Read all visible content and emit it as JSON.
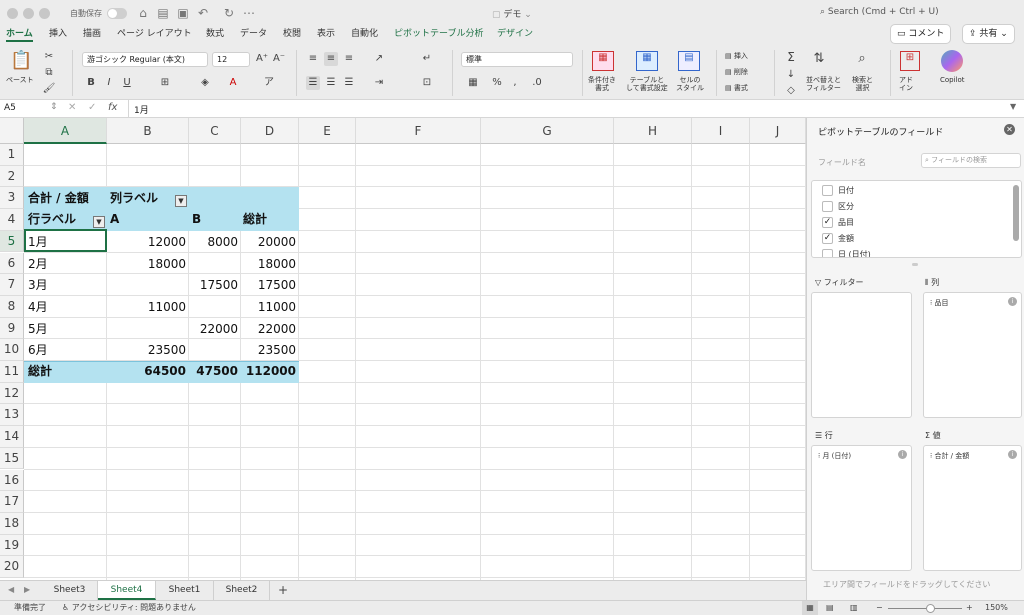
{
  "window": {
    "title": "デモ",
    "autosave_label": "自動保存",
    "search_placeholder": "Search (Cmd + Ctrl + U)"
  },
  "tabs": [
    "ホーム",
    "挿入",
    "描画",
    "ページ レイアウト",
    "数式",
    "データ",
    "校閲",
    "表示",
    "自動化",
    "ピボットテーブル分析",
    "デザイン"
  ],
  "header_buttons": {
    "comment": "コメント",
    "share": "共有"
  },
  "ribbon": {
    "paste": "ペースト",
    "font_name": "游ゴシック Regular (本文)",
    "font_size": "12",
    "number_format": "標準",
    "conditional_format": [
      "条件付き",
      "書式"
    ],
    "format_as_table": [
      "テーブルと",
      "して書式設定"
    ],
    "cell_styles": [
      "セルの",
      "スタイル"
    ],
    "insert": "挿入",
    "delete": "削除",
    "format": "書式",
    "sort_filter": [
      "並べ替えと",
      "フィルター"
    ],
    "find_select": [
      "検索と",
      "選択"
    ],
    "addins": [
      "アド",
      "イン"
    ],
    "copilot": "Copilot",
    "accent_color": "#1e7145"
  },
  "formula_bar": {
    "cell_ref": "A5",
    "fx": "fx",
    "value": "1月"
  },
  "columns": [
    "A",
    "B",
    "C",
    "D",
    "E",
    "F",
    "G",
    "H",
    "I",
    "J"
  ],
  "rows": [
    "1",
    "2",
    "3",
    "4",
    "5",
    "6",
    "7",
    "8",
    "9",
    "10",
    "11",
    "12",
    "13",
    "14",
    "15",
    "16",
    "17",
    "18",
    "19",
    "20"
  ],
  "pivot": {
    "header_sum": "合計 / 金額",
    "header_col_label": "列ラベル",
    "header_row_label": "行ラベル",
    "col_a": "A",
    "col_b": "B",
    "col_total": "総計",
    "data": [
      {
        "row": "1月",
        "a": "12000",
        "b": "8000",
        "total": "20000"
      },
      {
        "row": "2月",
        "a": "18000",
        "b": "",
        "total": "18000"
      },
      {
        "row": "3月",
        "a": "",
        "b": "17500",
        "total": "17500"
      },
      {
        "row": "4月",
        "a": "11000",
        "b": "",
        "total": "11000"
      },
      {
        "row": "5月",
        "a": "",
        "b": "22000",
        "total": "22000"
      },
      {
        "row": "6月",
        "a": "23500",
        "b": "",
        "total": "23500"
      }
    ],
    "grand": {
      "row": "総計",
      "a": "64500",
      "b": "47500",
      "total": "112000"
    },
    "header_color": "#b4e2f0"
  },
  "sheets": [
    "Sheet3",
    "Sheet4",
    "Sheet1",
    "Sheet2"
  ],
  "active_sheet": "Sheet4",
  "status": {
    "ready": "準備完了",
    "accessibility": "アクセシビリティ: 問題ありません",
    "zoom": "150%"
  },
  "pane": {
    "title": "ピボットテーブルのフィールド",
    "field_name_label": "フィールド名",
    "search_placeholder": "フィールドの検索",
    "fields": [
      {
        "name": "日付",
        "checked": false
      },
      {
        "name": "区分",
        "checked": false
      },
      {
        "name": "品目",
        "checked": true
      },
      {
        "name": "金額",
        "checked": true
      },
      {
        "name": "日 (日付)",
        "checked": false
      }
    ],
    "filters_label": "フィルター",
    "columns_label": "列",
    "rows_label": "行",
    "values_label": "値",
    "columns_item": "品目",
    "rows_item": "月 (日付)",
    "values_item": "合計 / 金額",
    "hint": "エリア間でフィールドをドラッグしてください"
  }
}
